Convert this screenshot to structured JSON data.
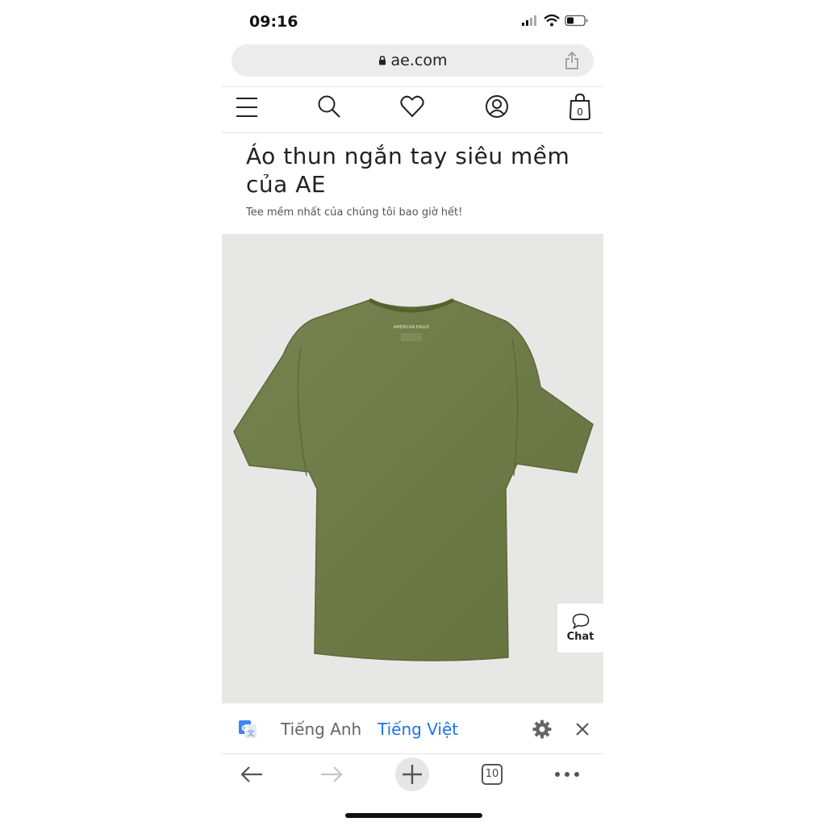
{
  "status": {
    "time": "09:16"
  },
  "browser": {
    "url": "ae.com"
  },
  "cart": {
    "count": "0"
  },
  "product": {
    "title": "Áo thun ngắn tay siêu mềm của AE",
    "subtitle": "Tee mềm nhất của chúng tôi bao giờ hết!",
    "image_alt": "olive green t-shirt",
    "shirt_color": "#6e7b4d"
  },
  "chat": {
    "label": "Chat"
  },
  "translate": {
    "source_lang": "Tiếng Anh",
    "target_lang": "Tiếng Việt"
  },
  "toolbar": {
    "tab_count": "10"
  },
  "colors": {
    "accent": "#1a73e8",
    "url_bar_bg": "#ececec",
    "photo_bg": "#e7e8e6"
  }
}
